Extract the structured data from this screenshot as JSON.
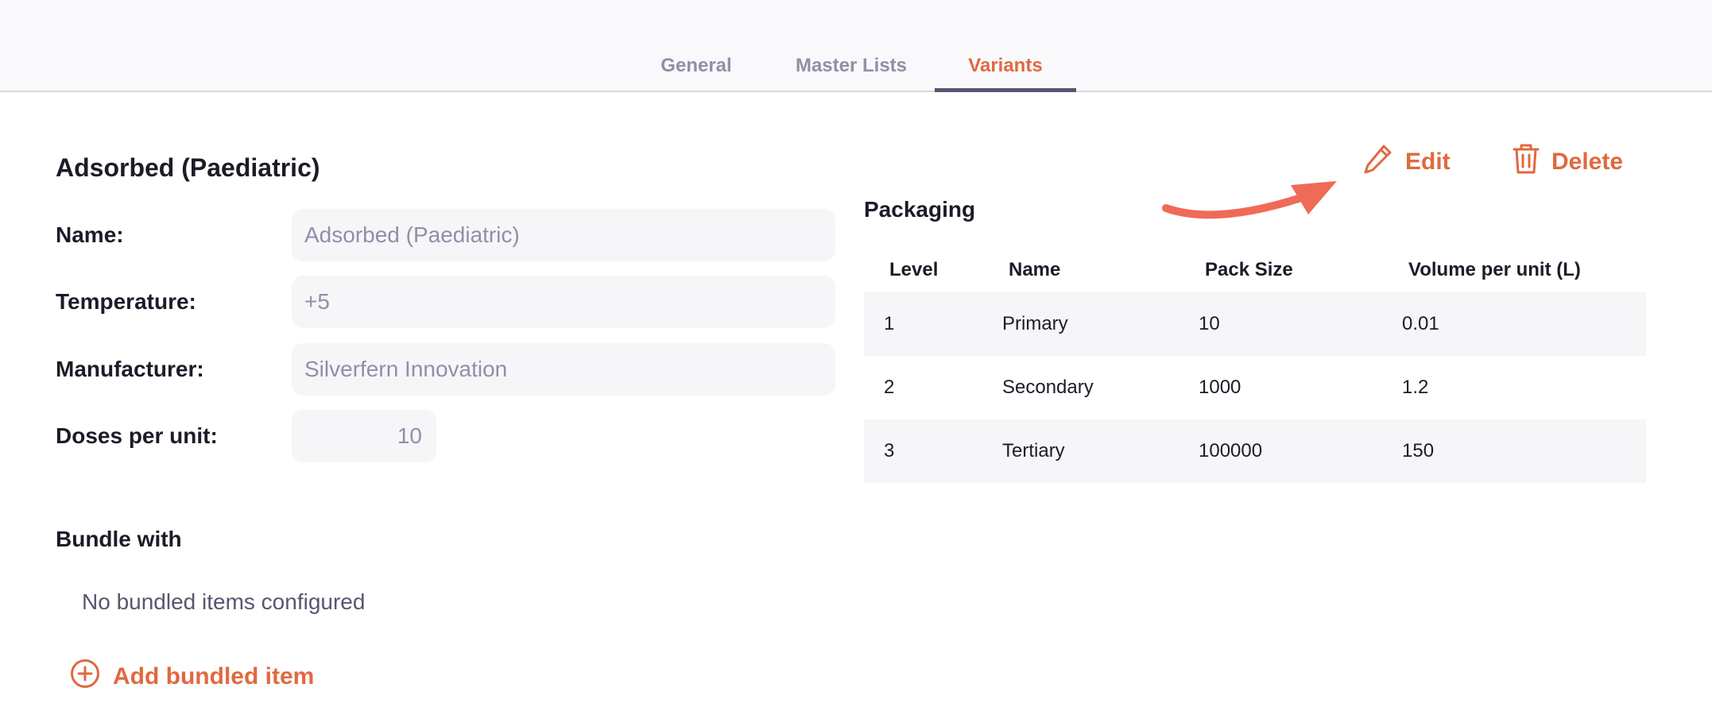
{
  "tabs": [
    {
      "label": "General",
      "active": false
    },
    {
      "label": "Master Lists",
      "active": false
    },
    {
      "label": "Variants",
      "active": true
    }
  ],
  "variant": {
    "title": "Adsorbed (Paediatric)",
    "fields": {
      "name_label": "Name:",
      "name_value": "Adsorbed (Paediatric)",
      "temperature_label": "Temperature:",
      "temperature_value": "+5",
      "manufacturer_label": "Manufacturer:",
      "manufacturer_value": "Silverfern Innovation",
      "doses_label": "Doses per unit:",
      "doses_value": "10"
    }
  },
  "bundle": {
    "title": "Bundle with",
    "empty_text": "No bundled items configured",
    "add_label": "Add bundled item"
  },
  "actions": {
    "edit_label": "Edit",
    "delete_label": "Delete"
  },
  "packaging": {
    "title": "Packaging",
    "headers": [
      "Level",
      "Name",
      "Pack Size",
      "Volume per unit (L)"
    ],
    "rows": [
      [
        "1",
        "Primary",
        "10",
        "0.01"
      ],
      [
        "2",
        "Secondary",
        "1000",
        "1.2"
      ],
      [
        "3",
        "Tertiary",
        "100000",
        "150"
      ]
    ]
  },
  "colors": {
    "accent": "#e0693f",
    "annotation_arrow": "#ef6b57",
    "tab_inactive": "#8f90a6",
    "tab_underline": "#555770",
    "input_bg": "#f6f6f9"
  }
}
